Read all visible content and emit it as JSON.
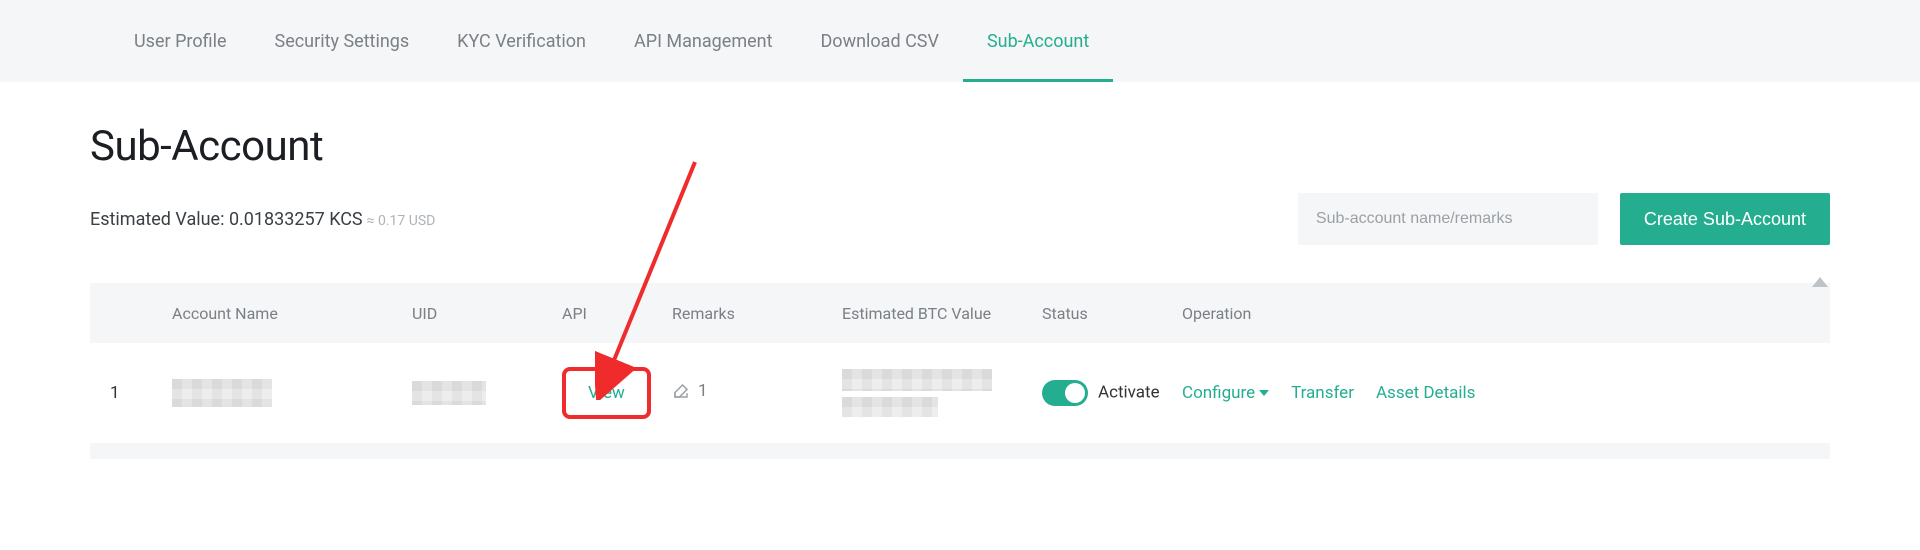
{
  "nav": {
    "items": [
      {
        "label": "User Profile",
        "active": false
      },
      {
        "label": "Security Settings",
        "active": false
      },
      {
        "label": "KYC Verification",
        "active": false
      },
      {
        "label": "API Management",
        "active": false
      },
      {
        "label": "Download CSV",
        "active": false
      },
      {
        "label": "Sub-Account",
        "active": true
      }
    ]
  },
  "page": {
    "title": "Sub-Account",
    "est_label": "Estimated Value: ",
    "est_value": "0.01833257 KCS",
    "est_approx": "≈ 0.17 USD"
  },
  "controls": {
    "search_placeholder": "Sub-account name/remarks",
    "create_label": "Create Sub-Account"
  },
  "table": {
    "headers": {
      "account_name": "Account Name",
      "uid": "UID",
      "api": "API",
      "remarks": "Remarks",
      "btc_value": "Estimated BTC Value",
      "status": "Status",
      "operation": "Operation"
    },
    "row1": {
      "index": "1",
      "view": "View",
      "remarks_count": "1",
      "status_label": "Activate",
      "op_configure": "Configure",
      "op_transfer": "Transfer",
      "op_asset": "Asset Details"
    }
  }
}
